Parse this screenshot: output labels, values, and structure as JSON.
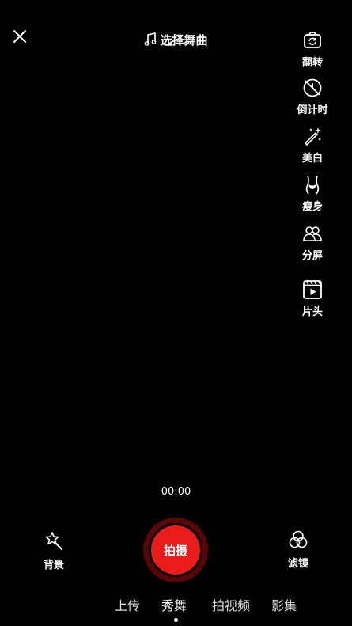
{
  "header": {
    "music_label": "选择舞曲"
  },
  "tools": [
    {
      "label": "翻转",
      "icon": "flip-camera-icon"
    },
    {
      "label": "倒计时",
      "icon": "countdown-icon"
    },
    {
      "label": "美白",
      "icon": "beauty-wand-icon"
    },
    {
      "label": "瘦身",
      "icon": "slim-body-icon"
    },
    {
      "label": "分屏",
      "icon": "split-screen-icon"
    },
    {
      "label": "片头",
      "icon": "intro-clip-icon"
    }
  ],
  "recording": {
    "time": "00:00",
    "shoot_label": "拍摄"
  },
  "left_action": {
    "label": "背景",
    "icon": "background-magic-icon"
  },
  "right_action": {
    "label": "滤镜",
    "icon": "filter-icon"
  },
  "mode_tabs": [
    {
      "label": "上传"
    },
    {
      "label": "秀舞",
      "active": true
    },
    {
      "label": "拍视频"
    },
    {
      "label": "影集"
    }
  ],
  "colors": {
    "shoot_button": "#ea1b1b",
    "background": "#000000"
  }
}
